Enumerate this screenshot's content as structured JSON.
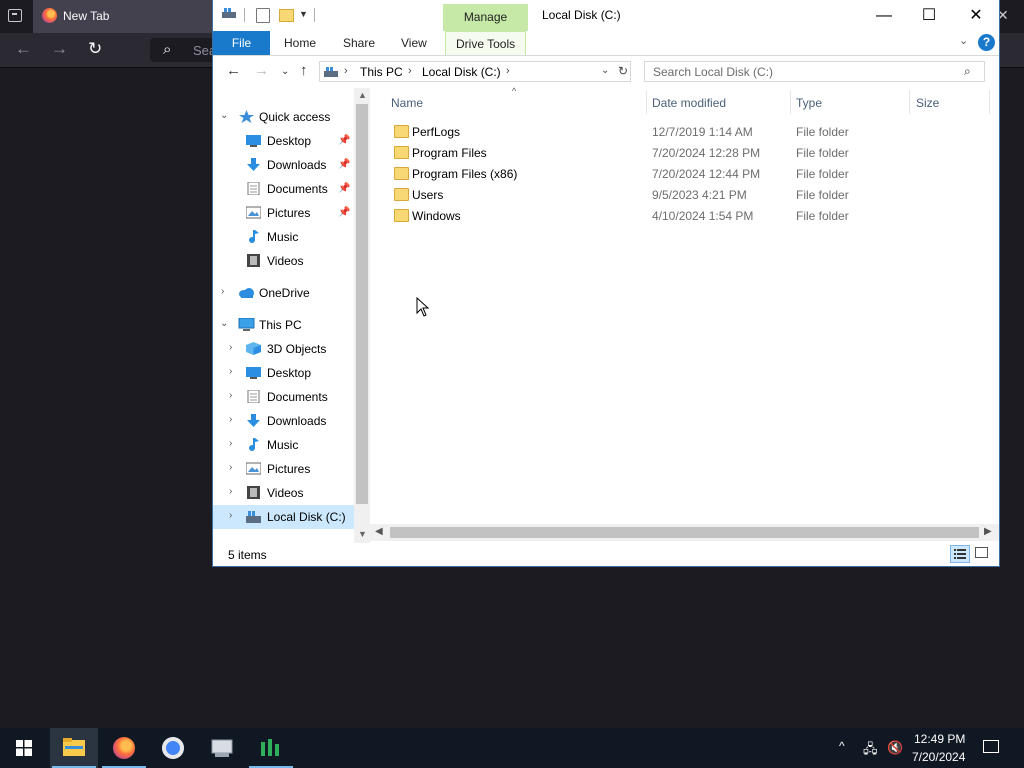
{
  "browser": {
    "tab_title": "New Tab",
    "search_partial": "Sea"
  },
  "explorer": {
    "window_title": "Local Disk (C:)",
    "manage_label": "Manage",
    "ribbon_tabs": [
      "File",
      "Home",
      "Share",
      "View",
      "Drive Tools"
    ],
    "address": {
      "crumbs": [
        "This PC",
        "Local Disk (C:)"
      ]
    },
    "search_placeholder": "Search Local Disk (C:)",
    "nav": {
      "quick_access": "Quick access",
      "quick_items": [
        "Desktop",
        "Downloads",
        "Documents",
        "Pictures",
        "Music",
        "Videos"
      ],
      "onedrive": "OneDrive",
      "this_pc": "This PC",
      "pc_items": [
        "3D Objects",
        "Desktop",
        "Documents",
        "Downloads",
        "Music",
        "Pictures",
        "Videos",
        "Local Disk (C:)"
      ]
    },
    "columns": {
      "name": "Name",
      "date": "Date modified",
      "type": "Type",
      "size": "Size"
    },
    "files": [
      {
        "name": "PerfLogs",
        "date": "12/7/2019 1:14 AM",
        "type": "File folder"
      },
      {
        "name": "Program Files",
        "date": "7/20/2024 12:28 PM",
        "type": "File folder"
      },
      {
        "name": "Program Files (x86)",
        "date": "7/20/2024 12:44 PM",
        "type": "File folder"
      },
      {
        "name": "Users",
        "date": "9/5/2023 4:21 PM",
        "type": "File folder"
      },
      {
        "name": "Windows",
        "date": "4/10/2024 1:54 PM",
        "type": "File folder"
      }
    ],
    "status": "5 items"
  },
  "taskbar": {
    "time": "12:49 PM",
    "date": "7/20/2024"
  },
  "colors": {
    "ribbon_file": "#1979ca",
    "manage_green": "#c6e9a8",
    "selection": "#cce8ff",
    "taskbar": "#101823"
  }
}
